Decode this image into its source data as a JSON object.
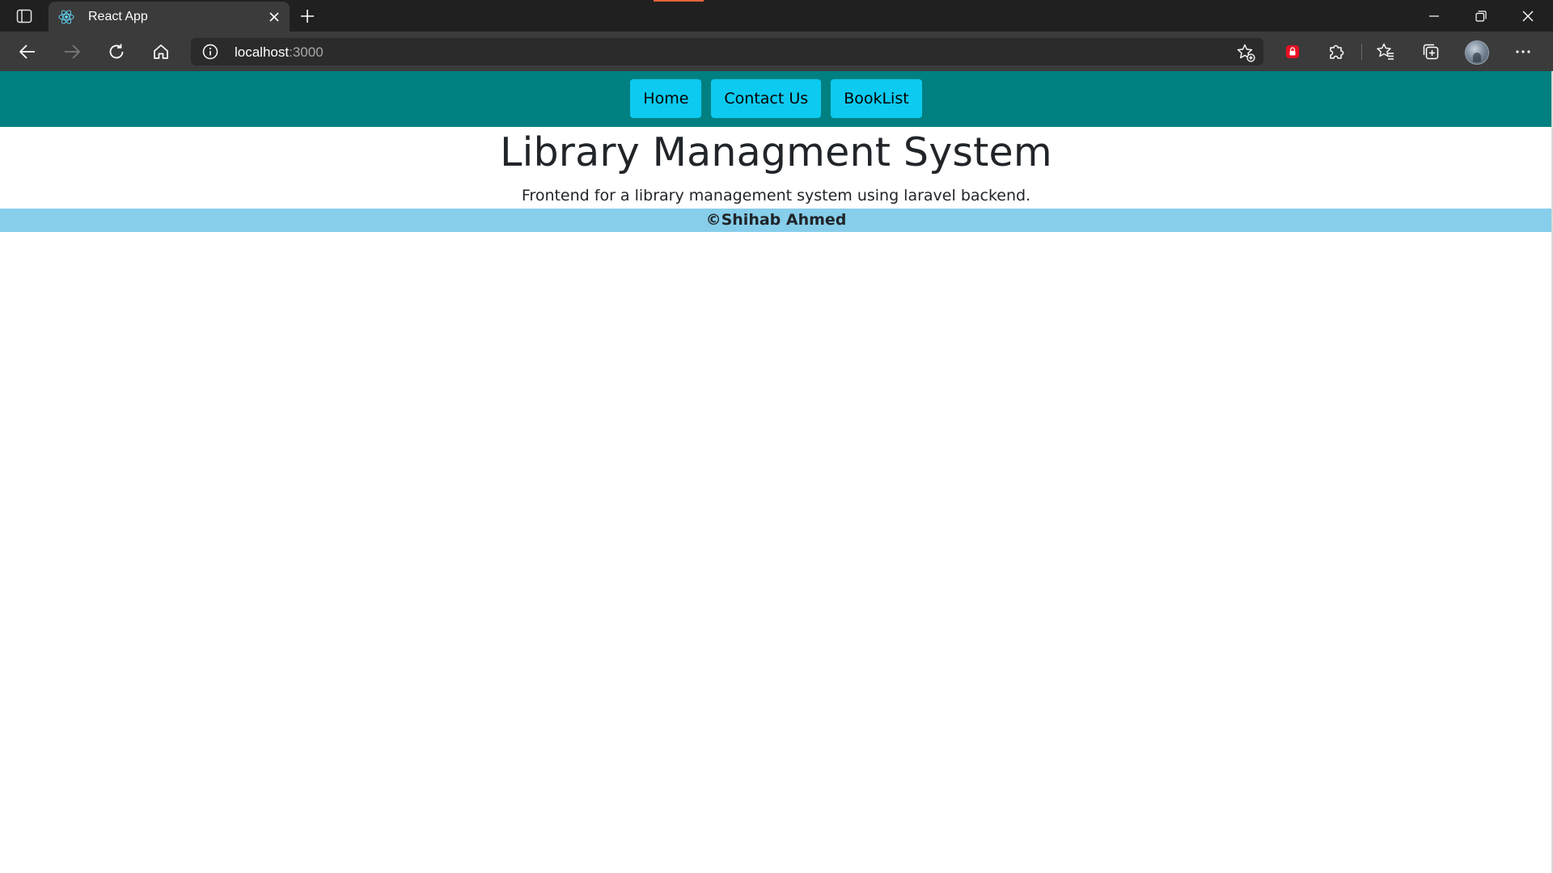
{
  "browser": {
    "tab": {
      "title": "React App",
      "favicon": "react-logo-icon"
    },
    "address": {
      "host": "localhost",
      "port": ":3000"
    },
    "icons": {
      "tab_list": "tab-list-icon",
      "close_tab": "close-icon",
      "new_tab": "plus-icon",
      "minimize": "minimize-icon",
      "restore": "restore-icon",
      "close_window": "close-icon",
      "back": "back-arrow-icon",
      "forward": "forward-arrow-icon",
      "refresh": "refresh-icon",
      "home": "home-icon",
      "site_info": "info-icon",
      "add_favorite": "star-plus-icon",
      "extension_red": "lock-shield-icon",
      "extensions": "puzzle-icon",
      "favorites": "favorites-icon",
      "collections": "collections-icon",
      "profile": "avatar",
      "more": "more-dots-icon"
    }
  },
  "page": {
    "nav": {
      "links": [
        {
          "label": "Home"
        },
        {
          "label": "Contact Us"
        },
        {
          "label": "BookList"
        }
      ]
    },
    "title": "Library Managment System",
    "subtitle": "Frontend for a library management system using laravel backend.",
    "footer": "©Shihab Ahmed"
  },
  "colors": {
    "navbar_bg": "#008080",
    "nav_button_bg": "#0dcaf0",
    "footer_bg": "#87ceeb",
    "text": "#212529"
  }
}
